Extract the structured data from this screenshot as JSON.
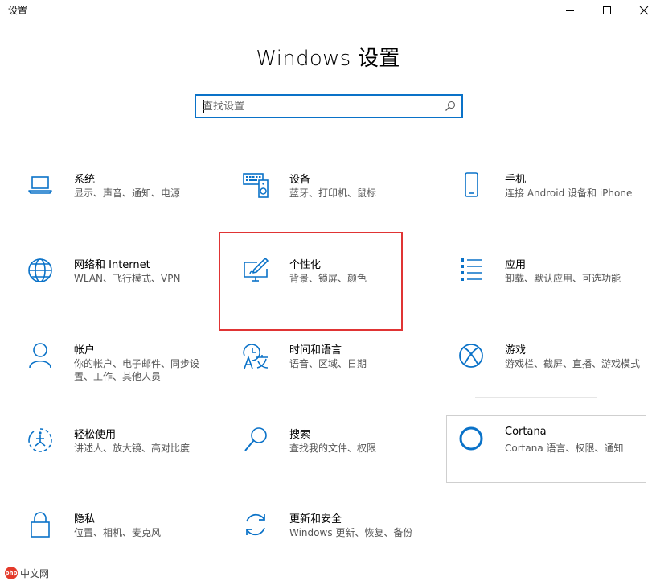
{
  "window": {
    "title": "设置",
    "controls": [
      "minimize-icon",
      "maximize-icon",
      "close-icon"
    ]
  },
  "page": {
    "title": "Windows 设置"
  },
  "search": {
    "placeholder": "查找设置",
    "value": ""
  },
  "accent_color": "#0a72c8",
  "highlight_color": "#e03434",
  "categories": [
    {
      "key": "system",
      "icon": "laptop-icon",
      "title": "系统",
      "desc": "显示、声音、通知、电源"
    },
    {
      "key": "devices",
      "icon": "keyboard-speaker-icon",
      "title": "设备",
      "desc": "蓝牙、打印机、鼠标"
    },
    {
      "key": "phone",
      "icon": "phone-icon",
      "title": "手机",
      "desc": "连接 Android 设备和 iPhone"
    },
    {
      "key": "network",
      "icon": "globe-icon",
      "title": "网络和 Internet",
      "desc": "WLAN、飞行模式、VPN"
    },
    {
      "key": "personalization",
      "icon": "monitor-pen-icon",
      "title": "个性化",
      "desc": "背景、锁屏、颜色"
    },
    {
      "key": "apps",
      "icon": "app-list-icon",
      "title": "应用",
      "desc": "卸载、默认应用、可选功能"
    },
    {
      "key": "accounts",
      "icon": "person-icon",
      "title": "帐户",
      "desc": "你的帐户、电子邮件、同步设置、工作、其他人员"
    },
    {
      "key": "time-language",
      "icon": "time-language-icon",
      "title": "时间和语言",
      "desc": "语音、区域、日期"
    },
    {
      "key": "gaming",
      "icon": "xbox-icon",
      "title": "游戏",
      "desc": "游戏栏、截屏、直播、游戏模式"
    },
    {
      "key": "ease-of-access",
      "icon": "ease-of-access-icon",
      "title": "轻松使用",
      "desc": "讲述人、放大镜、高对比度"
    },
    {
      "key": "search",
      "icon": "magnifier-icon",
      "title": "搜索",
      "desc": "查找我的文件、权限"
    },
    {
      "key": "cortana",
      "icon": "cortana-ring-icon",
      "title": "Cortana",
      "desc": "Cortana 语言、权限、通知"
    },
    {
      "key": "privacy",
      "icon": "lock-icon",
      "title": "隐私",
      "desc": "位置、相机、麦克风"
    },
    {
      "key": "update-security",
      "icon": "sync-arrows-icon",
      "title": "更新和安全",
      "desc": "Windows 更新、恢复、备份"
    }
  ],
  "watermark": {
    "logo": "php",
    "text": "中文网"
  }
}
